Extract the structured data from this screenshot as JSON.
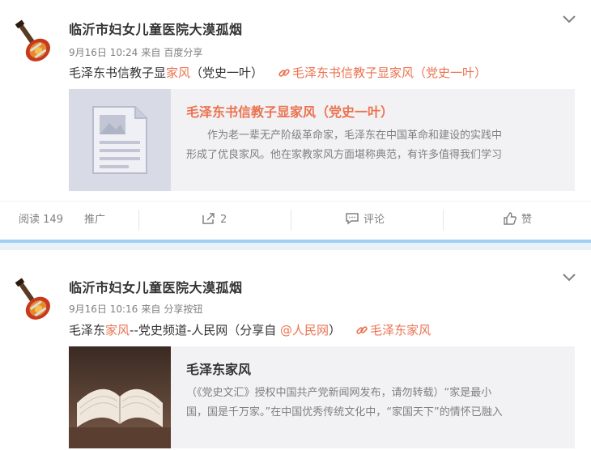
{
  "posts": [
    {
      "user_name": "临沂市妇女儿童医院大漠孤烟",
      "time": "9月16日 10:24",
      "source_prefix": "来自",
      "source": "百度分享",
      "text_parts": [
        "毛泽东书信教子显",
        "家风",
        "（党史一叶）"
      ],
      "link_text": "毛泽东书信教子显家风（党史一叶）",
      "card_title": "毛泽东书信教子显家风（党史一叶）",
      "card_desc": [
        "　　作为老一辈无产阶级革命家，毛泽东在中国革命和建设的实践中",
        "形成了优良家风。他在家教家风方面堪称典范，有许多值得我们学习"
      ],
      "thumb_icon": "document-icon"
    },
    {
      "user_name": "临沂市妇女儿童医院大漠孤烟",
      "time": "9月16日 10:16",
      "source_prefix": "来自",
      "source": "分享按钮",
      "text_parts": [
        "毛泽东",
        "家风",
        "--党史频道-人民网（分享自 ",
        "@人民网",
        "）"
      ],
      "link_text": "毛泽东家风",
      "card_title": "毛泽东家风",
      "card_desc": [
        "（《党史文汇》授权中国共产党新闻网发布，请勿转载）“家是最小",
        "国，国是千万家。”在中国优秀传统文化中，“家国天下”的情怀已融入"
      ],
      "thumb_icon": "open-book-image"
    }
  ],
  "actions": {
    "read_label": "阅读",
    "read_count": "149",
    "promote": "推广",
    "repost_count": "2",
    "comment": "评论",
    "like": "赞"
  },
  "colors": {
    "highlight": "#eb7350",
    "meta": "#808080",
    "divider": "#9fd0f0"
  }
}
